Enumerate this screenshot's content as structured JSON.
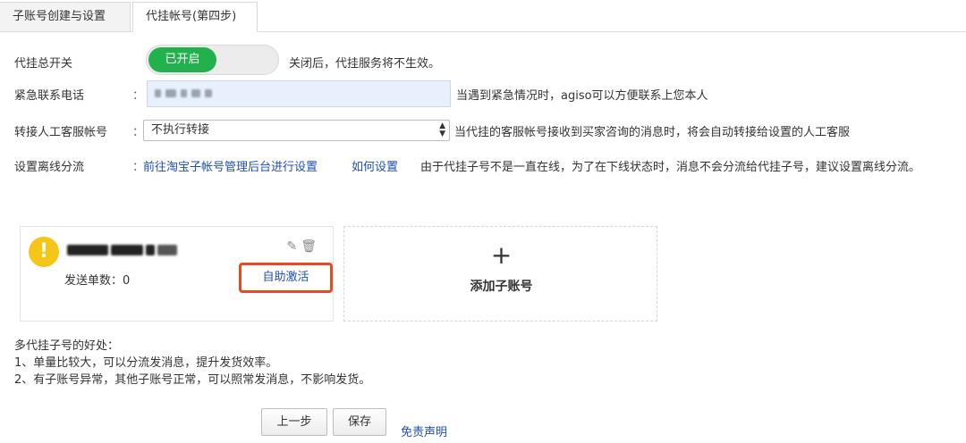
{
  "tabs": [
    {
      "label": "子账号创建与设置"
    },
    {
      "label": "代挂帐号(第四步)"
    }
  ],
  "master_switch": {
    "label": "代挂总开关",
    "toggle_label": "已开启",
    "hint": "关闭后，代挂服务将不生效。",
    "on_color": "#22b14c"
  },
  "emergency_phone": {
    "label": "紧急联系电话",
    "colon": "：",
    "hint": "当遇到紧急情况时，agiso可以方便联系上您本人"
  },
  "transfer": {
    "label": "转接人工客服帐号",
    "colon": "：",
    "selected": "不执行转接",
    "hint": "当代挂的客服帐号接收到买家咨询的消息时，将会自动转接给设置的人工客服"
  },
  "offline_split": {
    "label": "设置离线分流",
    "colon": "：",
    "link_backend": "前往淘宝子帐号管理后台进行设置",
    "link_howto": "如何设置",
    "hint": "由于代挂子号不是一直在线，为了在下线状态时，消息不会分流给代挂子号，建议设置离线分流。"
  },
  "account_card": {
    "icon": "warning-icon",
    "sent_count": "发送单数：0",
    "activate_label": "自助激活",
    "highlight_color": "#e84a1e"
  },
  "add_account": {
    "plus": "+",
    "label": "添加子账号"
  },
  "benefits": {
    "title": "多代挂子号的好处：",
    "items": [
      "1、单量比较大，可以分流发消息，提升发货效率。",
      "2、有子账号异常，其他子账号正常，可以照常发消息，不影响发货。"
    ]
  },
  "footer": {
    "prev_label": "上一步",
    "save_label": "保存",
    "disclaimer": "免责声明"
  }
}
